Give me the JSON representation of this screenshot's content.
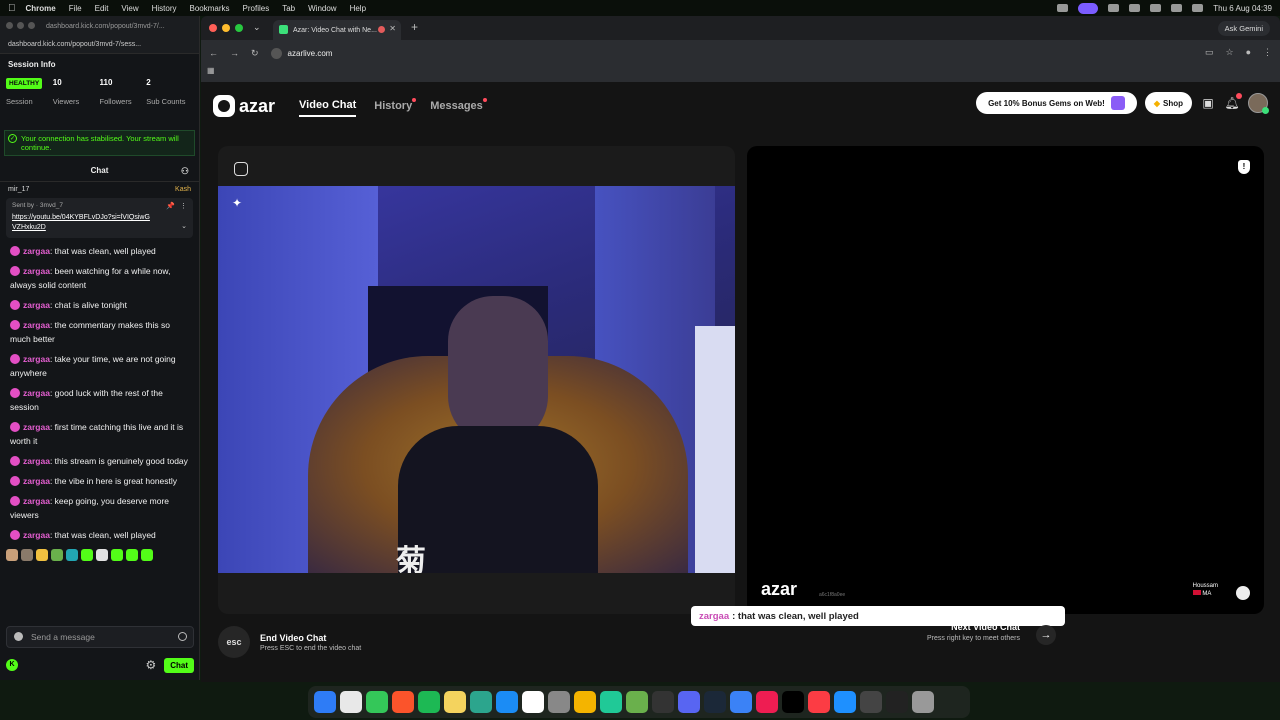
{
  "menubar": {
    "app": "Chrome",
    "items": [
      "File",
      "Edit",
      "View",
      "History",
      "Bookmarks",
      "Profiles",
      "Tab",
      "Window",
      "Help"
    ],
    "datetime": "Thu 6 Aug  04:39"
  },
  "popout": {
    "title": "dashboard.kick.com/popout/3mvd-7/...",
    "url": "dashboard.kick.com/popout/3mvd-7/sess...",
    "session_title": "Session Info",
    "stats": [
      {
        "value": "HEALTHY",
        "label": "Session"
      },
      {
        "value": "10",
        "label": "Viewers"
      },
      {
        "value": "110",
        "label": "Followers"
      },
      {
        "value": "2",
        "label": "Sub Counts"
      }
    ],
    "notice": "Your connection has stabilised. Your stream will continue.",
    "chat_title": "Chat",
    "pinned_row_user": "mir_17",
    "pinned_row_kash": "Kash",
    "pinned": {
      "sent_by": "Sent by",
      "sender": "3mvd_7",
      "link": "https://youtu.be/04KYBFLvDJo?si=lVIQsiwGVZHxku2D"
    },
    "messages": [
      {
        "user": "zargaa",
        "text": ": that was clean, well played"
      },
      {
        "user": "zargaa",
        "text": ": been watching for a while now, always solid content"
      },
      {
        "user": "zargaa",
        "text": ": chat is alive tonight"
      },
      {
        "user": "zargaa",
        "text": ": the commentary makes this so much better"
      },
      {
        "user": "zargaa",
        "text": ": take your time, we are not going anywhere"
      },
      {
        "user": "zargaa",
        "text": ": good luck with the rest of the session"
      },
      {
        "user": "zargaa",
        "text": ": first time catching this live and it is worth it"
      },
      {
        "user": "zargaa",
        "text": ": this stream is genuinely good today"
      },
      {
        "user": "zargaa",
        "text": ": the vibe in here is great honestly"
      },
      {
        "user": "zargaa",
        "text": ": keep going, you deserve more viewers"
      },
      {
        "user": "zargaa",
        "text": ": that was clean, well played"
      }
    ],
    "input_placeholder": "Send a message",
    "chat_button": "Chat"
  },
  "browser": {
    "tab_title": "Azar: Video Chat with Ne...",
    "address": "azarlive.com",
    "gemini": "Ask Gemini"
  },
  "azar": {
    "logo": "azar",
    "nav": [
      {
        "label": "Video Chat",
        "active": true,
        "dot": false
      },
      {
        "label": "History",
        "active": false,
        "dot": true
      },
      {
        "label": "Messages",
        "active": false,
        "dot": true
      }
    ],
    "bonus": "Get 10% Bonus Gems on Web!",
    "shop": "Shop",
    "shirt_text": "菊",
    "partner_watermark": "azar",
    "partner_id": "a6c1f8a0ee",
    "partner_name": "Houssam",
    "partner_country": "MA",
    "end_title": "End Video Chat",
    "end_sub": "Press ESC to end the video chat",
    "esc_key": "esc",
    "overlay_user": "zargaa",
    "overlay_text": ": that was clean, well played",
    "next_title": "Next Video Chat",
    "next_sub": "Press right key to meet others"
  }
}
